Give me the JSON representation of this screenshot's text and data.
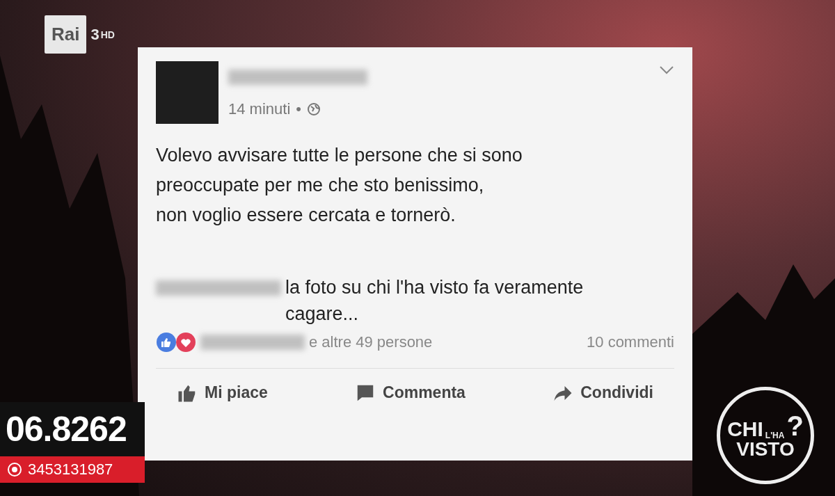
{
  "channel_logo": {
    "name": "Rai",
    "number": "3",
    "suffix": "HD"
  },
  "post": {
    "time": "14 minuti",
    "separator": "•",
    "text_lines": [
      "Volevo avvisare tutte le persone che si sono",
      "preoccupate per me che sto benissimo,",
      "non voglio essere cercata e tornerò."
    ],
    "comment": "la foto su chi l'ha visto fa veramente cagare...",
    "reactions_text": "e altre 49 persone",
    "comments_count": "10 commenti",
    "actions": [
      {
        "kind": "like",
        "label": "Mi piace"
      },
      {
        "kind": "comment",
        "label": "Commenta"
      },
      {
        "kind": "share",
        "label": "Condividi"
      }
    ]
  },
  "phone": {
    "number": "06.8262",
    "whatsapp": "3453131987"
  },
  "show_logo": {
    "word_1": "CHI",
    "word_2": "L'HA",
    "word_3": "VISTO",
    "mark": "?"
  }
}
